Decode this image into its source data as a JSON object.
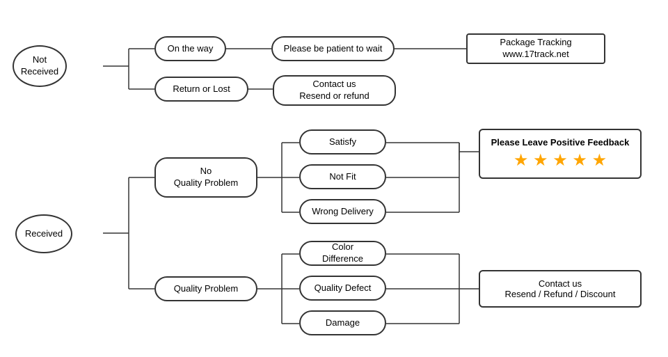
{
  "nodes": {
    "not_received": {
      "label": "Not\nReceived"
    },
    "on_the_way": {
      "label": "On the way"
    },
    "return_or_lost": {
      "label": "Return or Lost"
    },
    "please_be_patient": {
      "label": "Please be patient to wait"
    },
    "package_tracking": {
      "label": "Package Tracking\nwww.17track.net"
    },
    "contact_resend_refund": {
      "label": "Contact us\nResend or refund"
    },
    "received": {
      "label": "Received"
    },
    "no_quality_problem": {
      "label": "No\nQuality Problem"
    },
    "quality_problem": {
      "label": "Quality Problem"
    },
    "satisfy": {
      "label": "Satisfy"
    },
    "not_fit": {
      "label": "Not Fit"
    },
    "wrong_delivery": {
      "label": "Wrong Delivery"
    },
    "color_difference": {
      "label": "Color Difference"
    },
    "quality_defect": {
      "label": "Quality Defect"
    },
    "damage": {
      "label": "Damage"
    },
    "please_leave_feedback": {
      "label": "Please Leave Positive Feedback"
    },
    "stars": {
      "label": "★ ★ ★ ★ ★"
    },
    "contact_resend_refund_discount": {
      "label": "Contact us\nResend / Refund / Discount"
    }
  }
}
